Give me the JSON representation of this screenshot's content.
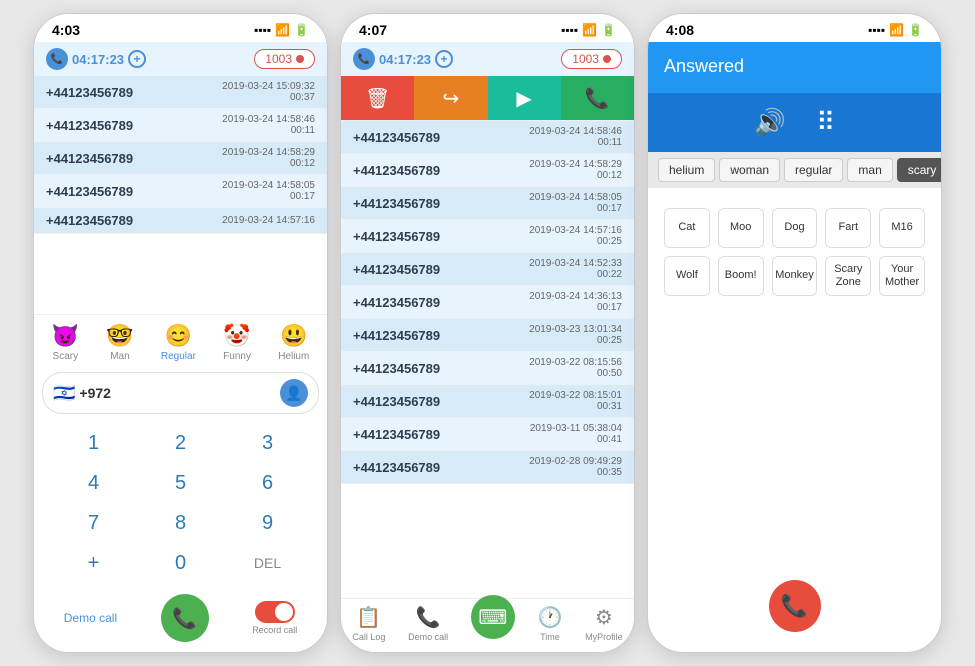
{
  "phone1": {
    "status_time": "4:03",
    "header": {
      "timer": "04:17:23",
      "count": "1003"
    },
    "calls": [
      {
        "number": "+44123456789",
        "date": "2019-03-24 15:09:32",
        "duration": "00:37"
      },
      {
        "number": "+44123456789",
        "date": "2019-03-24 14:58:46",
        "duration": "00:11"
      },
      {
        "number": "+44123456789",
        "date": "2019-03-24 14:58:29",
        "duration": "00:12"
      },
      {
        "number": "+44123456789",
        "date": "2019-03-24 14:58:05",
        "duration": "00:17"
      },
      {
        "number": "+44123456789",
        "date": "2019-03-24 14:57:16",
        "duration": ""
      }
    ],
    "voices": [
      {
        "id": "scary",
        "label": "Scary",
        "icon": "😈",
        "active": false
      },
      {
        "id": "man",
        "label": "Man",
        "icon": "🤓",
        "active": false
      },
      {
        "id": "regular",
        "label": "Regular",
        "icon": "😊",
        "active": true
      },
      {
        "id": "funny",
        "label": "Funny",
        "icon": "🤡",
        "active": false
      },
      {
        "id": "helium",
        "label": "Helium",
        "icon": "😃",
        "active": false
      }
    ],
    "country_code": "+972",
    "keypad": {
      "rows": [
        [
          "1",
          "2",
          "3"
        ],
        [
          "4",
          "5",
          "6"
        ],
        [
          "7",
          "8",
          "9"
        ],
        [
          "+",
          "0",
          "DEL"
        ]
      ]
    },
    "demo_call_label": "Demo call",
    "record_call_label": "Record call"
  },
  "phone2": {
    "status_time": "4:07",
    "header": {
      "timer": "04:17:23",
      "count": "1003"
    },
    "context_menu": {
      "delete": "🗑",
      "share": "↪",
      "play": "▶",
      "call": "📞"
    },
    "calls": [
      {
        "number": "+44123456789",
        "date": "2019-03-24 14:58:46",
        "duration": "00:11"
      },
      {
        "number": "+44123456789",
        "date": "2019-03-24 14:58:29",
        "duration": "00:12"
      },
      {
        "number": "+44123456789",
        "date": "2019-03-24 14:58:05",
        "duration": "00:17"
      },
      {
        "number": "+44123456789",
        "date": "2019-03-24 14:57:16",
        "duration": "00:25"
      },
      {
        "number": "+44123456789",
        "date": "2019-03-24 14:52:33",
        "duration": "00:22"
      },
      {
        "number": "+44123456789",
        "date": "2019-03-24 14:36:13",
        "duration": "00:17"
      },
      {
        "number": "+44123456789",
        "date": "2019-03-23 13:01:34",
        "duration": "00:25"
      },
      {
        "number": "+44123456789",
        "date": "2019-03-22 08:15:56",
        "duration": "00:50"
      },
      {
        "number": "+44123456789",
        "date": "2019-03-22 08:15:01",
        "duration": "00:31"
      },
      {
        "number": "+44123456789",
        "date": "2019-03-11 05:38:04",
        "duration": "00:41"
      },
      {
        "number": "+44123456789",
        "date": "2019-02-28 09:49:29",
        "duration": "00:35"
      }
    ],
    "nav": [
      {
        "id": "call-log",
        "label": "Call Log",
        "icon": "📋"
      },
      {
        "id": "demo-call",
        "label": "Demo call",
        "icon": "📞"
      },
      {
        "id": "keypad",
        "label": "",
        "icon": "⌨",
        "center": true
      },
      {
        "id": "time",
        "label": "Time",
        "icon": "🕐"
      },
      {
        "id": "myprofile",
        "label": "MyProfile",
        "icon": "⚙"
      }
    ]
  },
  "phone3": {
    "status_time": "4:08",
    "answered_label": "Answered",
    "voice_tabs": [
      {
        "id": "helium",
        "label": "helium",
        "active": false
      },
      {
        "id": "woman",
        "label": "woman",
        "active": false
      },
      {
        "id": "regular",
        "label": "regular",
        "active": false
      },
      {
        "id": "man",
        "label": "man",
        "active": false
      },
      {
        "id": "scary",
        "label": "scary",
        "active": true
      }
    ],
    "sound_buttons": [
      [
        "Cat",
        "Moo",
        "Dog",
        "Fart",
        "M16"
      ],
      [
        "Wolf",
        "Boom!",
        "Monkey",
        "Scary Zone",
        "Your Mother"
      ]
    ]
  }
}
